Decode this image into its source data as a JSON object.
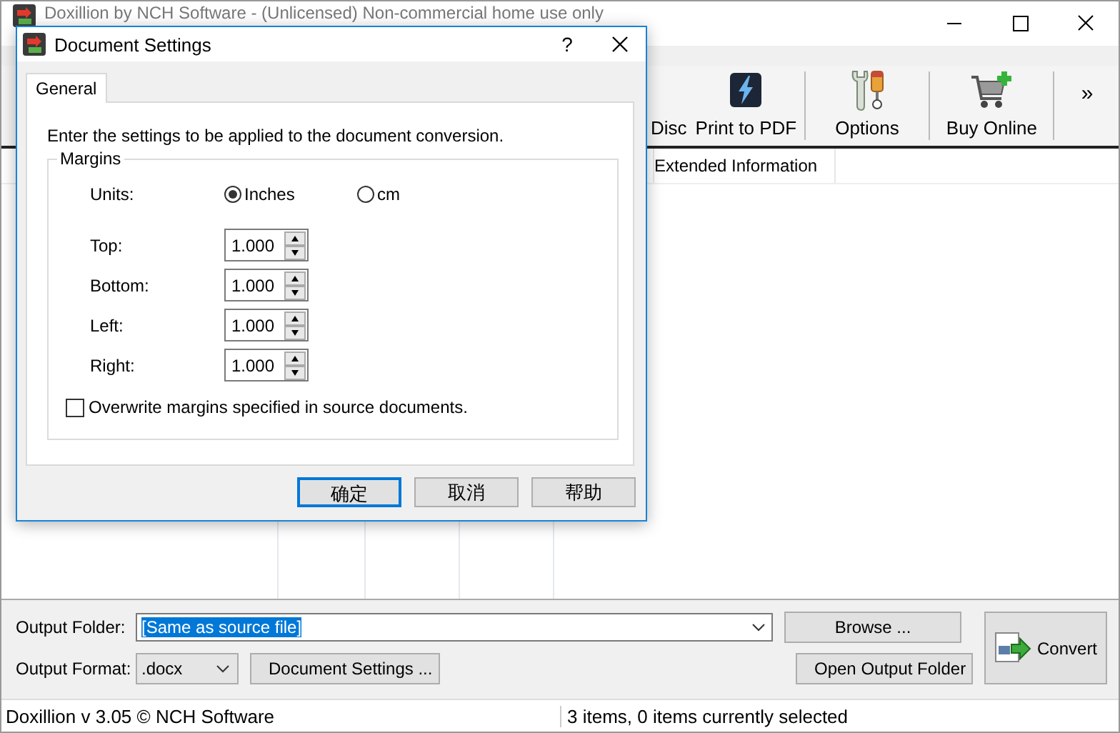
{
  "window": {
    "title": "Doxillion by NCH Software - (Unlicensed) Non-commercial home use only"
  },
  "toolbar": {
    "buttons": [
      {
        "label": "Disc",
        "kind": "cut"
      },
      {
        "label": "Print to PDF",
        "kind": "pdf"
      },
      {
        "label": "Options",
        "kind": "options"
      },
      {
        "label": "Buy Online",
        "kind": "cart"
      }
    ],
    "overflow": "»"
  },
  "file_list": {
    "columns": [
      "Extended Information"
    ]
  },
  "output": {
    "folder_label": "Output Folder:",
    "folder_value": "[Same as source file]",
    "folder_text_selected": true,
    "format_label": "Output Format:",
    "format_value": ".docx",
    "settings_button": "Document Settings ...",
    "browse_button": "Browse ...",
    "open_button": "Open Output Folder",
    "convert_button": "Convert"
  },
  "status_bar": {
    "left": "Doxillion v 3.05 © NCH Software",
    "right": "3 items, 0 items currently selected"
  },
  "dialog": {
    "title": "Document Settings",
    "help": "?",
    "tabs": [
      {
        "label": "General",
        "selected": true
      }
    ],
    "intro": "Enter the settings to be applied to the document conversion.",
    "group": "Margins",
    "units_label": "Units:",
    "units": [
      {
        "label": "Inches",
        "selected": true
      },
      {
        "label": "cm",
        "selected": false
      }
    ],
    "margins": [
      {
        "label": "Top:",
        "value": "1.000"
      },
      {
        "label": "Bottom:",
        "value": "1.000"
      },
      {
        "label": "Left:",
        "value": "1.000"
      },
      {
        "label": "Right:",
        "value": "1.000"
      }
    ],
    "overwrite": {
      "label": "Overwrite margins specified in source documents.",
      "checked": false
    },
    "buttons": [
      {
        "label": "确定",
        "focused": true
      },
      {
        "label": "取消",
        "focused": false
      },
      {
        "label": "帮助",
        "focused": false
      }
    ]
  }
}
